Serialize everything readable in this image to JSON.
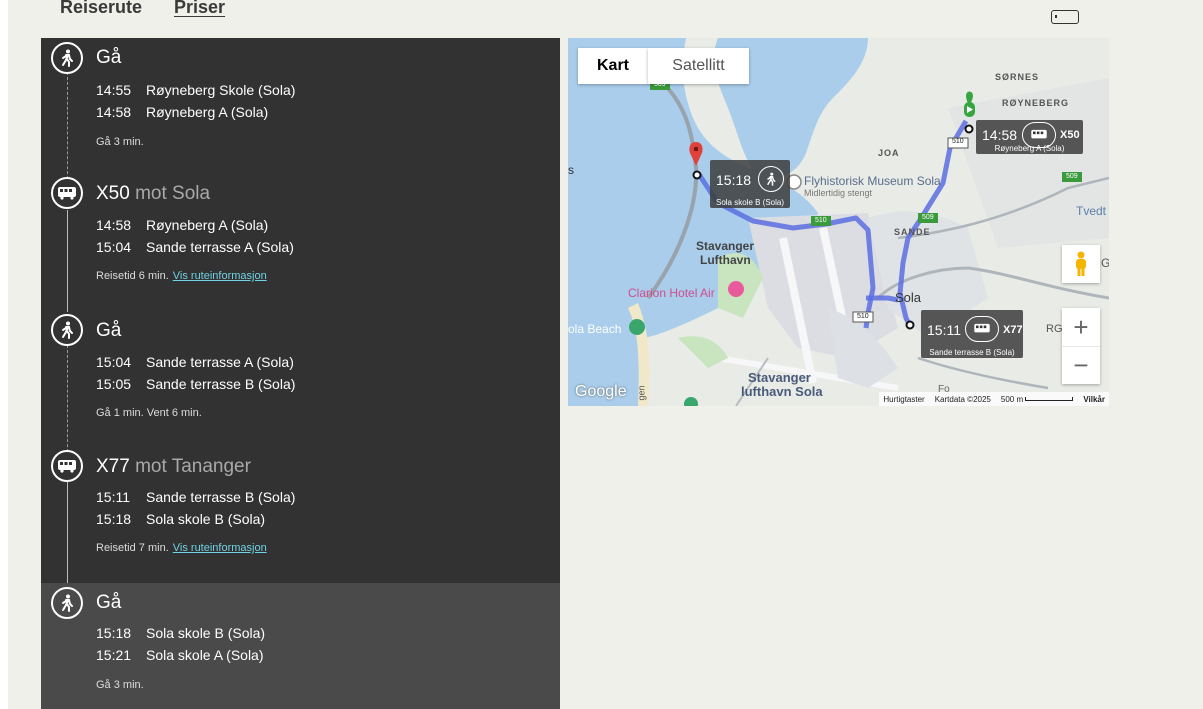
{
  "tabs": {
    "route": "Reiserute",
    "prices": "Priser"
  },
  "legs": [
    {
      "mode": "walk",
      "title": "Gå",
      "destination": "",
      "rows": [
        {
          "time": "14:55",
          "stop": "Røyneberg Skole (Sola)"
        },
        {
          "time": "14:58",
          "stop": "Røyneberg A (Sola)"
        }
      ],
      "note": "Gå 3 min.",
      "link": ""
    },
    {
      "mode": "bus",
      "title": "X50",
      "destination": "mot Sola",
      "rows": [
        {
          "time": "14:58",
          "stop": "Røyneberg A (Sola)"
        },
        {
          "time": "15:04",
          "stop": "Sande terrasse A (Sola)"
        }
      ],
      "note": "Reisetid 6 min.",
      "link": "Vis ruteinformasjon"
    },
    {
      "mode": "walk",
      "title": "Gå",
      "destination": "",
      "rows": [
        {
          "time": "15:04",
          "stop": "Sande terrasse A (Sola)"
        },
        {
          "time": "15:05",
          "stop": "Sande terrasse B (Sola)"
        }
      ],
      "note": "Gå 1 min. Vent 6 min.",
      "link": ""
    },
    {
      "mode": "bus",
      "title": "X77",
      "destination": "mot Tananger",
      "rows": [
        {
          "time": "15:11",
          "stop": "Sande terrasse B (Sola)"
        },
        {
          "time": "15:18",
          "stop": "Sola skole B (Sola)"
        }
      ],
      "note": "Reisetid 7 min.",
      "link": "Vis ruteinformasjon"
    },
    {
      "mode": "walk",
      "title": "Gå",
      "destination": "",
      "rows": [
        {
          "time": "15:18",
          "stop": "Sola skole B (Sola)"
        },
        {
          "time": "15:21",
          "stop": "Sola skole A (Sola)"
        }
      ],
      "note": "Gå 3 min.",
      "link": ""
    }
  ],
  "map": {
    "tab_map": "Kart",
    "tab_satellite": "Satellitt",
    "places": {
      "sornes": "SØRNES",
      "royneberg": "RØYNEBERG",
      "joa": "JOA",
      "museum": "Flyhistorisk Museum Sola",
      "museum_sub": "Midlertidig stengt",
      "tvedt": "Tvedt",
      "sande": "SANDE",
      "airport1": "Stavanger",
      "airport2": "Lufthavn",
      "hotel": "Clarion Hotel Air",
      "sola": "Sola",
      "beach": "ola Beach",
      "lufthavn1": "Stavanger",
      "lufthavn2": "lufthavn Sola",
      "s": "s",
      "gen": "gen",
      "fo": "Fo",
      "g": "G",
      "rg": "RG"
    },
    "roads": {
      "r509a": "509",
      "r509b": "509",
      "r510a": "510",
      "r510b": "510",
      "r509c": "509",
      "r510c": "510"
    },
    "bubbles": {
      "start": {
        "time": "14:58",
        "route": "X50",
        "stop": "Røyneberg A (Sola)"
      },
      "end": {
        "time": "15:18",
        "stop": "Sola skole B (Sola)"
      },
      "mid": {
        "time": "15:11",
        "route": "X77",
        "stop": "Sande terrasse B (Sola)"
      }
    },
    "zoom_in": "+",
    "zoom_out": "−",
    "google": "Google",
    "attribution": {
      "shortcuts": "Hurtigtaster",
      "data": "Kartdata ©2025",
      "scale": "500 m",
      "terms": "Vilkår"
    }
  }
}
